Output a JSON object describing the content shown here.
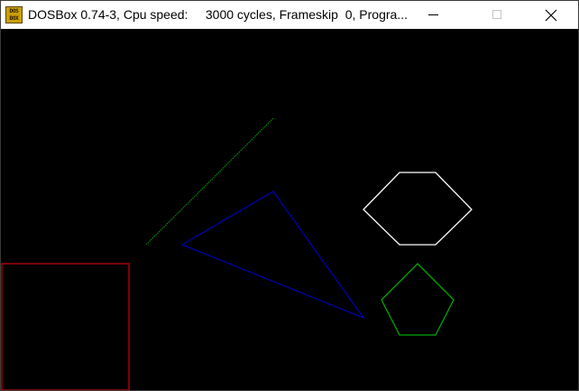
{
  "window": {
    "title": "DOSBox 0.74-3, Cpu speed:     3000 cycles, Frameskip  0, Progra...",
    "icon_text_top": "DOS",
    "icon_text_bottom": "BOX"
  },
  "controls": {
    "minimize_icon": "minimize-icon",
    "maximize_icon": "maximize-icon",
    "close_icon": "close-icon",
    "maximize_enabled": false
  },
  "screen": {
    "background": "#000000",
    "shapes": [
      {
        "kind": "line",
        "name": "green-line",
        "color": "#00a800"
      },
      {
        "kind": "triangle",
        "name": "blue-triangle",
        "color": "#0000a8"
      },
      {
        "kind": "hexagon",
        "name": "white-hexagon",
        "color": "#ffffff"
      },
      {
        "kind": "pentagon",
        "name": "green-pentagon",
        "color": "#00a800"
      },
      {
        "kind": "rectangle",
        "name": "red-rectangle",
        "color": "#a80000"
      }
    ]
  }
}
